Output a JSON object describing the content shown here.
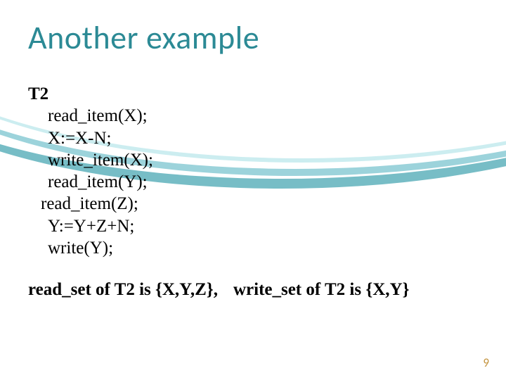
{
  "title": "Another example",
  "transaction": {
    "name": "T2",
    "lines": [
      "read_item(X);",
      "X:=X-N;",
      "write_item(X);",
      "read_item(Y);",
      "read_item(Z);",
      "Y:=Y+Z+N;",
      "write(Y);"
    ]
  },
  "readset_text": "read_set of T2 is {X,Y,Z},",
  "writeset_text": "write_set of T2 is {X,Y}",
  "page_number": "9"
}
